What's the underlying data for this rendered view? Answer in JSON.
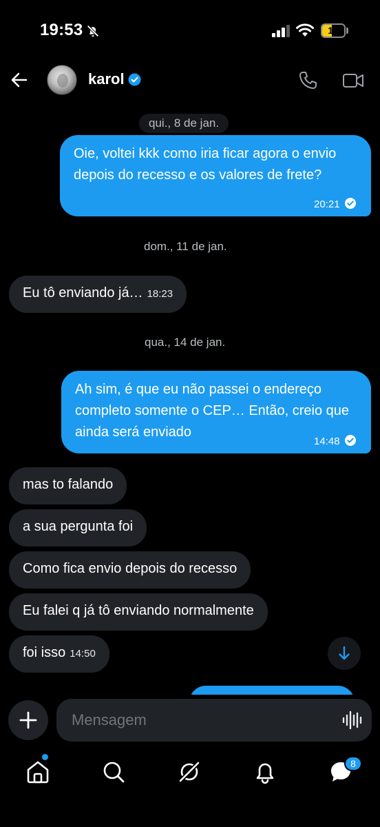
{
  "status_bar": {
    "time": "19:53",
    "battery": "16"
  },
  "header": {
    "contact_name": "karol"
  },
  "chat": {
    "date_1": "qui., 8 de jan.",
    "msg_1_text": "Oie, voltei kkk como iria ficar agora o envio depois do recesso e os valores de frete?",
    "msg_1_time": "20:21",
    "date_2": "dom., 11 de jan.",
    "msg_2_text": "Eu tô enviando já…",
    "msg_2_time": "18:23",
    "date_3": "qua., 14 de jan.",
    "msg_3_text": "Ah sim, é que eu não passei o endereço completo somente o CEP… Então, creio que ainda será enviado",
    "msg_3_time": "14:48",
    "msg_4_text": "mas to falando",
    "msg_5_text": "a sua pergunta foi",
    "msg_6_text": "Como fica envio depois do recesso",
    "msg_7_text": "Eu falei q já tô enviando normalmente",
    "msg_8_text": "foi isso",
    "msg_8_time": "14:50"
  },
  "composer": {
    "placeholder": "Mensagem"
  },
  "bottom_nav": {
    "messages_badge": "8"
  },
  "colors": {
    "accent": "#1d9bf0",
    "incoming_bubble": "#202327",
    "background": "#000000"
  }
}
